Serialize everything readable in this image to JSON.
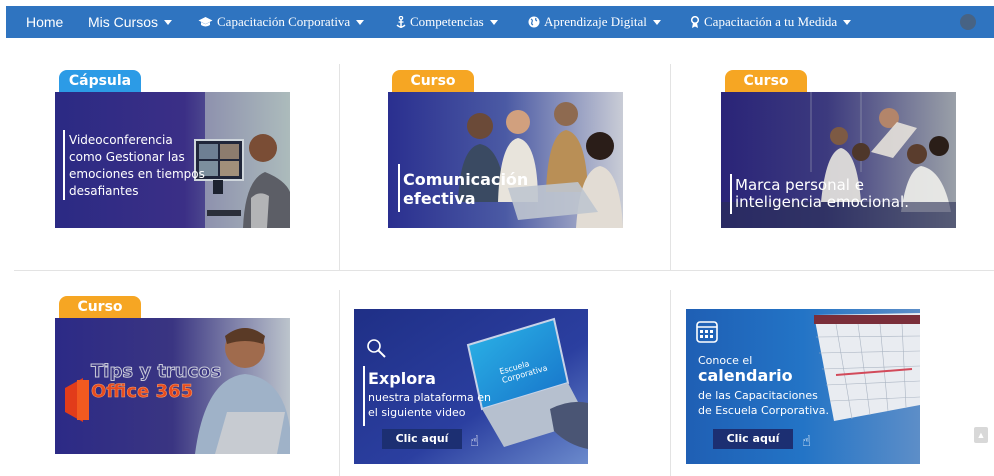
{
  "nav": {
    "items": [
      {
        "label": "Home",
        "icon": "",
        "style": "sans",
        "dropdown": false
      },
      {
        "label": "Mis Cursos",
        "icon": "",
        "style": "sans",
        "dropdown": true
      },
      {
        "label": "Capacitación Corporativa",
        "icon": "graduation-cap-icon",
        "style": "serif",
        "dropdown": true
      },
      {
        "label": "Competencias",
        "icon": "anchor-icon",
        "style": "serif",
        "dropdown": true
      },
      {
        "label": "Aprendizaje Digital",
        "icon": "globe-icon",
        "style": "serif",
        "dropdown": true
      },
      {
        "label": "Capacitación a tu Medida",
        "icon": "medal-icon",
        "style": "serif",
        "dropdown": true
      }
    ]
  },
  "cards": [
    {
      "tag": "Cápsula",
      "tag_color": "#2c9be6",
      "title_lines": [
        "Videoconferencia",
        "como Gestionar las",
        "emociones en tiempos",
        "desafiantes"
      ]
    },
    {
      "tag": "Curso",
      "tag_color": "#f6a623",
      "title_lines": [
        "Comunicación",
        "efectiva"
      ]
    },
    {
      "tag": "Curso",
      "tag_color": "#f6a623",
      "title_lines": [
        "Marca personal e",
        "inteligencia emocional."
      ]
    },
    {
      "tag": "Curso",
      "tag_color": "#f6a623",
      "title_lines": [
        "Tips y trucos",
        "Office 365"
      ]
    }
  ],
  "promo_explora": {
    "heading": "Explora",
    "lines": [
      "nuestra plataforma en",
      "el siguiente video"
    ],
    "button": "Clic aquí",
    "screen_text": "Escuela Corporativa"
  },
  "promo_calendario": {
    "small": "Conoce el",
    "heading": "calendario",
    "lines": [
      "de las Capacitaciones",
      "de Escuela Corporativa."
    ],
    "button": "Clic aquí"
  },
  "colors": {
    "nav_bg": "#2f74c0",
    "tag_blue": "#2c9be6",
    "tag_orange": "#f6a623",
    "banner_dark": "#1c2f72"
  }
}
